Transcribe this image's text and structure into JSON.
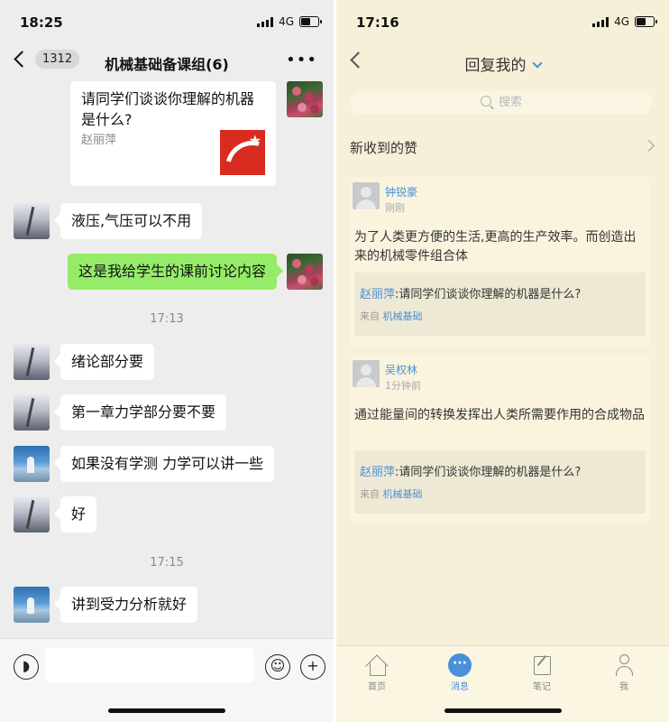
{
  "left": {
    "status": {
      "time": "18:25",
      "network": "4G"
    },
    "header": {
      "unread_count": "1312",
      "title": "机械基础备课组(6)",
      "more": "•••"
    },
    "share_card": {
      "title": "请同学们谈谈你理解的机器是什么?",
      "author": "赵丽萍"
    },
    "messages": [
      {
        "text": "液压,气压可以不用"
      },
      {
        "text": "这是我给学生的课前讨论内容"
      },
      {
        "text": "绪论部分要"
      },
      {
        "text": "第一章力学部分要不要"
      },
      {
        "text": "如果没有学测 力学可以讲一些"
      },
      {
        "text": "好"
      },
      {
        "text": "讲到受力分析就好"
      }
    ],
    "timestamps": [
      "17:13",
      "17:15"
    ],
    "input": {
      "placeholder": ""
    }
  },
  "right": {
    "status": {
      "time": "17:16",
      "network": "4G"
    },
    "header": {
      "title": "回复我的"
    },
    "search": {
      "placeholder": "搜索"
    },
    "likes_row": {
      "label": "新收到的赞"
    },
    "replies": [
      {
        "name": "钟锐豪",
        "time": "刚刚",
        "content": "为了人类更方便的生活,更高的生产效率。而创造出来的机械零件组合体",
        "quote_author": "赵丽萍",
        "quote_sep": ":",
        "quote_text": "请同学们谈谈你理解的机器是什么?",
        "from_label": "来自",
        "from_course": "机械基础"
      },
      {
        "name": "吴权林",
        "time": "1分钟前",
        "content": "通过能量间的转换发挥出人类所需要作用的合成物品",
        "quote_author": "赵丽萍",
        "quote_sep": ":",
        "quote_text": "请同学们谈谈你理解的机器是什么?",
        "from_label": "来自",
        "from_course": "机械基础"
      }
    ],
    "tabs": [
      {
        "label": "首页",
        "icon": "home-icon"
      },
      {
        "label": "消息",
        "icon": "message-icon"
      },
      {
        "label": "笔记",
        "icon": "note-icon"
      },
      {
        "label": "我",
        "icon": "profile-icon"
      }
    ],
    "active_tab": "消息"
  },
  "colors": {
    "wechat_green_bubble": "#95ec69",
    "chat_bg": "#ededed",
    "app_bg": "#f7f0d8",
    "accent_blue": "#4a90d9",
    "logo_red": "#d92b1f"
  }
}
